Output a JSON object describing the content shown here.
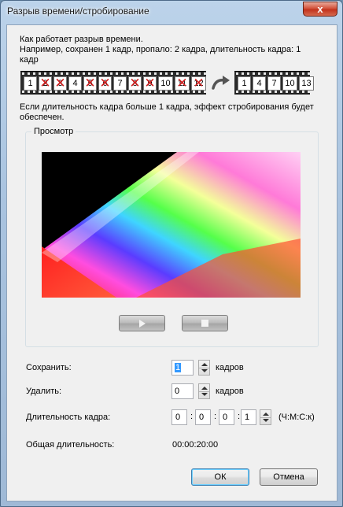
{
  "window": {
    "title": "Разрыв времени/стробирование",
    "close_glyph": "x"
  },
  "description": {
    "line1": "Как работает разрыв времени.",
    "line2": "Например, сохранен 1 кадр, пропало: 2 кадра, длительность кадра: 1 кадр",
    "strobe_note": "Если длительность кадра больше 1 кадра, эффект стробирования будет обеспечен."
  },
  "illustration": {
    "source_frames": [
      {
        "label": "1",
        "dropped": false
      },
      {
        "label": "2",
        "dropped": true
      },
      {
        "label": "3",
        "dropped": true
      },
      {
        "label": "4",
        "dropped": false
      },
      {
        "label": "5",
        "dropped": true
      },
      {
        "label": "6",
        "dropped": true
      },
      {
        "label": "7",
        "dropped": false
      },
      {
        "label": "8",
        "dropped": true
      },
      {
        "label": "9",
        "dropped": true
      },
      {
        "label": "10",
        "dropped": false
      },
      {
        "label": "11",
        "dropped": true
      },
      {
        "label": "12",
        "dropped": true
      }
    ],
    "result_frames": [
      "1",
      "4",
      "7",
      "10",
      "13"
    ],
    "arrow_icon": "curved-arrow-right-icon"
  },
  "preview": {
    "group_label": "Просмотр",
    "play_icon": "play-icon",
    "stop_icon": "stop-icon"
  },
  "settings": {
    "keep": {
      "label": "Сохранить:",
      "value": "1",
      "unit": "кадров"
    },
    "drop": {
      "label": "Удалить:",
      "value": "0",
      "unit": "кадров"
    },
    "frame_duration": {
      "label": "Длительность кадра:",
      "hours": "0",
      "minutes": "0",
      "seconds": "0",
      "frames": "1",
      "separator": ":",
      "format_hint": "(Ч:М:С:к)"
    },
    "total_duration": {
      "label": "Общая длительность:",
      "value": "00:00:20:00"
    }
  },
  "buttons": {
    "ok": "ОК",
    "cancel": "Отмена"
  }
}
